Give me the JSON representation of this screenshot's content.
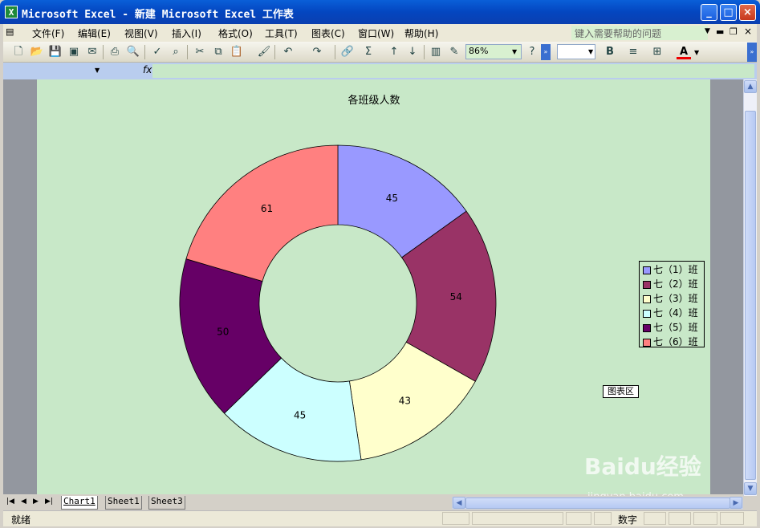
{
  "window": {
    "title": "Microsoft Excel - 新建 Microsoft Excel 工作表",
    "app_icon": "excel-icon",
    "controls": [
      "minimize",
      "maximize",
      "close"
    ]
  },
  "menubar": {
    "items": [
      "文件(F)",
      "编辑(E)",
      "视图(V)",
      "插入(I)",
      "格式(O)",
      "工具(T)",
      "图表(C)",
      "窗口(W)",
      "帮助(H)"
    ],
    "help_placeholder": "键入需要帮助的问题",
    "doc_controls": [
      "minimize",
      "restore",
      "close"
    ]
  },
  "toolbar": {
    "zoom": "86%",
    "bold_label": "B",
    "font_color_label": "A"
  },
  "formulabar": {
    "fx_label": "fx",
    "name_box": "",
    "formula": ""
  },
  "chart_data": {
    "type": "doughnut",
    "title": "各班级人数",
    "categories": [
      "七（1）班",
      "七（2）班",
      "七（3）班",
      "七（4）班",
      "七（5）班",
      "七（6）班"
    ],
    "values": [
      45,
      54,
      43,
      45,
      50,
      61
    ],
    "colors": [
      "#9999ff",
      "#993366",
      "#ffffcc",
      "#ccffff",
      "#660066",
      "#ff8080"
    ],
    "legend_position": "right",
    "data_labels": [
      "45",
      "54",
      "43",
      "45",
      "50",
      "61"
    ]
  },
  "chart_tooltip": "图表区",
  "sheet_tabs": [
    "Chart1",
    "Sheet1",
    "Sheet3"
  ],
  "active_tab": "Chart1",
  "statusbar": {
    "left": "就绪",
    "right": "数字"
  },
  "watermark": {
    "brand": "Baidu经验",
    "url": "jingyan.baidu.com"
  }
}
